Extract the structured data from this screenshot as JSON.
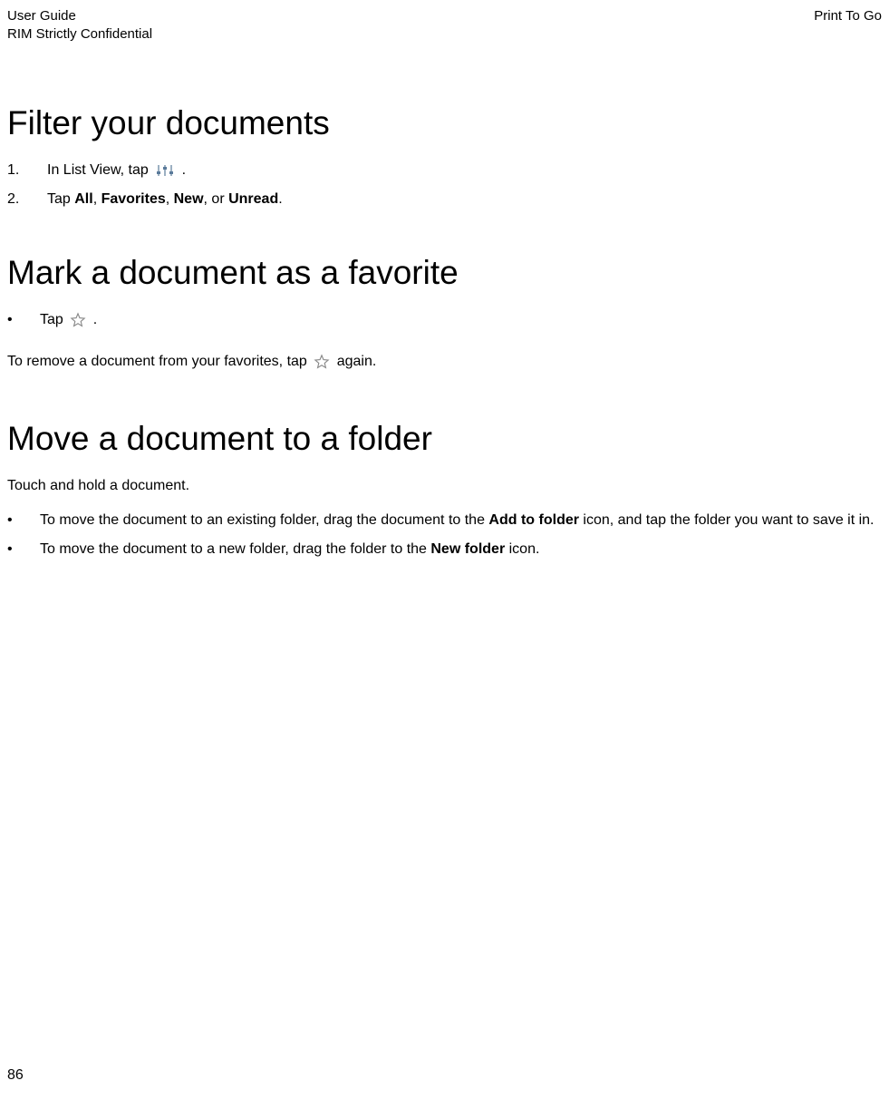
{
  "header": {
    "left_line1": "User Guide",
    "left_line2": "RIM Strictly Confidential",
    "right": "Print To Go"
  },
  "section1": {
    "title": "Filter your documents",
    "step1_marker": "1.",
    "step1_pre": "In List View, tap ",
    "step1_post": " .",
    "step2_marker": "2.",
    "step2_pre": "Tap ",
    "step2_b1": "All",
    "step2_t1": ", ",
    "step2_b2": "Favorites",
    "step2_t2": ", ",
    "step2_b3": "New",
    "step2_t3": ", or ",
    "step2_b4": "Unread",
    "step2_t4": "."
  },
  "section2": {
    "title": "Mark a document as a favorite",
    "bullet_marker": "•",
    "bullet_pre": "Tap ",
    "bullet_post": " .",
    "para_pre": "To remove a document from your favorites, tap ",
    "para_post": " again."
  },
  "section3": {
    "title": "Move a document to a folder",
    "intro": "Touch and hold a document.",
    "bullet_marker": "•",
    "b1_t1": "To move the document to an existing folder, drag the document to the ",
    "b1_b1": "Add to folder",
    "b1_t2": " icon, and tap the folder you want to save it in.",
    "b2_t1": "To move the document to a new folder, drag the folder to the ",
    "b2_b1": "New folder",
    "b2_t2": " icon."
  },
  "page_number": "86"
}
